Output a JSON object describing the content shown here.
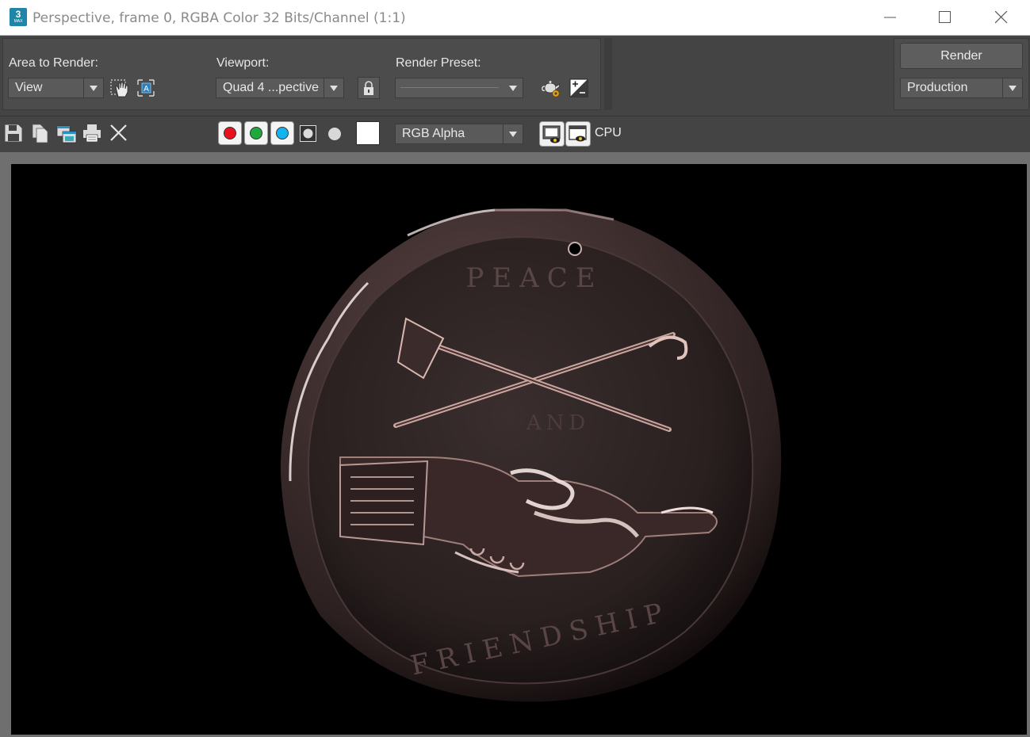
{
  "window": {
    "icon_number": "3",
    "icon_text": "MAX",
    "title": "Perspective, frame 0, RGBA Color 32 Bits/Channel (1:1)"
  },
  "toolbar": {
    "area_to_render_label": "Area to Render:",
    "area_to_render_value": "View",
    "viewport_label": "Viewport:",
    "viewport_value": "Quad 4 ...pective",
    "render_preset_label": "Render Preset:",
    "render_preset_value": "",
    "render_button": "Render",
    "render_mode_value": "Production"
  },
  "channel_bar": {
    "channel_display_value": "RGB Alpha",
    "renderer_label": "CPU",
    "channel_colors": {
      "red": "#e8121e",
      "green": "#1fa83c",
      "blue": "#12b4ef"
    }
  },
  "icons": [
    "region-hand-icon",
    "auto-region-icon",
    "lock-icon",
    "teapot-settings-icon",
    "exposure-icon",
    "save-icon",
    "copy-icon",
    "clone-window-icon",
    "print-icon",
    "clear-icon",
    "monochrome-icon",
    "display-toggle-icon",
    "render-display-icon"
  ]
}
